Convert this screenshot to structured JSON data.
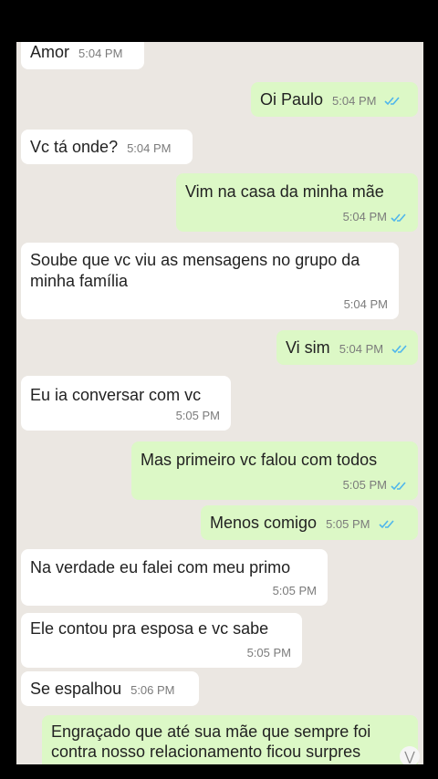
{
  "messages": [
    {
      "text": "Amor",
      "time": "5:04 PM"
    },
    {
      "text": "Oi Paulo",
      "time": "5:04 PM"
    },
    {
      "text": "Vc tá onde?",
      "time": "5:04 PM"
    },
    {
      "text": "Vim na casa da minha mãe",
      "time": "5:04 PM"
    },
    {
      "text": "Soube que vc viu as mensagens no grupo da minha família",
      "time": "5:04 PM"
    },
    {
      "text": "Vi sim",
      "time": "5:04 PM"
    },
    {
      "text": "Eu ia conversar com vc",
      "time": "5:05 PM"
    },
    {
      "text": "Mas primeiro vc falou com todos",
      "time": "5:05 PM"
    },
    {
      "text": "Menos comigo",
      "time": "5:05 PM"
    },
    {
      "text": "Na verdade eu falei com meu primo",
      "time": "5:05 PM"
    },
    {
      "text": "Ele contou pra esposa e vc sabe",
      "time": "5:05 PM"
    },
    {
      "text": "Se espalhou",
      "time": "5:06 PM"
    },
    {
      "text": "Engraçado que até sua mãe que sempre foi contra nosso relacionamento ficou surpres"
    }
  ],
  "icons": {
    "read_ticks": "double-check-icon",
    "scroll": "chevron-double-down-icon"
  },
  "colors": {
    "incoming": "#ffffff",
    "outgoing": "#dcf8c6",
    "ticks": "#4fb6ec",
    "background": "#ebe7e2"
  }
}
